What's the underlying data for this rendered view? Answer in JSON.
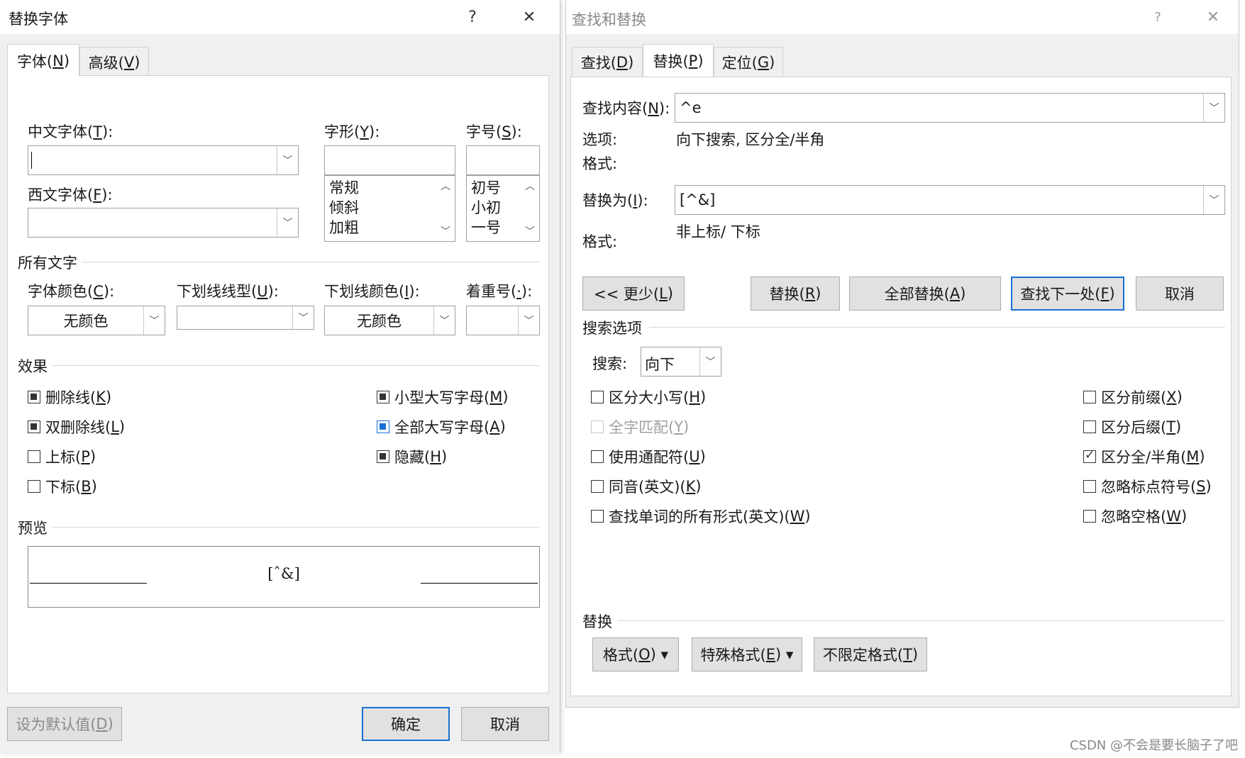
{
  "font_dialog": {
    "title": "替换字体",
    "help": "?",
    "close": "✕",
    "tabs": [
      {
        "label": "字体(",
        "key": "N",
        "end": ")"
      },
      {
        "label": "高级(",
        "key": "V",
        "end": ")"
      }
    ],
    "chinese_font": {
      "label": "中文字体(",
      "key": "T",
      "end": "):",
      "value": ""
    },
    "style": {
      "label": "字形(",
      "key": "Y",
      "end": "):",
      "items": [
        "常规",
        "倾斜",
        "加粗"
      ]
    },
    "size": {
      "label": "字号(",
      "key": "S",
      "end": "):",
      "items": [
        "初号",
        "小初",
        "一号"
      ]
    },
    "western_font": {
      "label": "西文字体(",
      "key": "F",
      "end": "):",
      "value": ""
    },
    "all_text": "所有文字",
    "font_color": {
      "label": "字体颜色(",
      "key": "C",
      "end": "):",
      "value": "无颜色"
    },
    "underline_style": {
      "label": "下划线线型(",
      "key": "U",
      "end": "):",
      "value": ""
    },
    "underline_color": {
      "label": "下划线颜色(",
      "key": "I",
      "end": "):",
      "value": "无颜色"
    },
    "emphasis": {
      "label": "着重号(",
      "key": "·",
      "end": "):",
      "value": ""
    },
    "effects": "效果",
    "effects_left": [
      {
        "label": "删除线(",
        "key": "K",
        "end": ")",
        "state": "indeterminate"
      },
      {
        "label": "双删除线(",
        "key": "L",
        "end": ")",
        "state": "indeterminate"
      },
      {
        "label": "上标(",
        "key": "P",
        "end": ")",
        "state": "unchecked"
      },
      {
        "label": "下标(",
        "key": "B",
        "end": ")",
        "state": "unchecked"
      }
    ],
    "effects_right": [
      {
        "label": "小型大写字母(",
        "key": "M",
        "end": ")",
        "state": "indeterminate"
      },
      {
        "label": "全部大写字母(",
        "key": "A",
        "end": ")",
        "state": "indeterminate-blue"
      },
      {
        "label": "隐藏(",
        "key": "H",
        "end": ")",
        "state": "indeterminate"
      }
    ],
    "preview": "预览",
    "preview_text": "[ˆ&]",
    "set_default": {
      "label": "设为默认值(",
      "key": "D",
      "end": ")"
    },
    "ok": "确定",
    "cancel": "取消"
  },
  "find_dialog": {
    "title": "查找和替换",
    "help": "?",
    "close": "✕",
    "tabs": [
      {
        "label": "查找(",
        "key": "D",
        "end": ")"
      },
      {
        "label": "替换(",
        "key": "P",
        "end": ")"
      },
      {
        "label": "定位(",
        "key": "G",
        "end": ")"
      }
    ],
    "find_what": {
      "label": "查找内容(",
      "key": "N",
      "end": "):",
      "value": "^e"
    },
    "options_label": "选项:",
    "options_value": "向下搜索, 区分全/半角",
    "format_label": "格式:",
    "replace_with": {
      "label": "替换为(",
      "key": "I",
      "end": "):",
      "value": "[^&]"
    },
    "format_value": "非上标/ 下标",
    "buttons": {
      "less": {
        "label": "<< 更少(",
        "key": "L",
        "end": ")"
      },
      "replace": {
        "label": "替换(",
        "key": "R",
        "end": ")"
      },
      "replace_all": {
        "label": "全部替换(",
        "key": "A",
        "end": ")"
      },
      "find_next": {
        "label": "查找下一处(",
        "key": "F",
        "end": ")"
      },
      "cancel": "取消"
    },
    "search_options": "搜索选项",
    "search_label": "搜索:",
    "search_value": "向下",
    "left_opts": [
      {
        "label": "区分大小写(",
        "key": "H",
        "end": ")",
        "state": "unchecked"
      },
      {
        "label": "全字匹配(",
        "key": "Y",
        "end": ")",
        "state": "disabled"
      },
      {
        "label": "使用通配符(",
        "key": "U",
        "end": ")",
        "state": "unchecked"
      },
      {
        "label": "同音(英文)(",
        "key": "K",
        "end": ")",
        "state": "unchecked"
      },
      {
        "label": "查找单词的所有形式(英文)(",
        "key": "W",
        "end": ")",
        "state": "unchecked"
      }
    ],
    "right_opts": [
      {
        "label": "区分前缀(",
        "key": "X",
        "end": ")",
        "state": "unchecked"
      },
      {
        "label": "区分后缀(",
        "key": "T",
        "end": ")",
        "state": "unchecked"
      },
      {
        "label": "区分全/半角(",
        "key": "M",
        "end": ")",
        "state": "checked"
      },
      {
        "label": "忽略标点符号(",
        "key": "S",
        "end": ")",
        "state": "unchecked"
      },
      {
        "label": "忽略空格(",
        "key": "W",
        "end": ")",
        "state": "unchecked"
      }
    ],
    "replace_section": "替换",
    "format_btn": {
      "label": "格式(",
      "key": "O",
      "end": ") ▾"
    },
    "special_btn": {
      "label": "特殊格式(",
      "key": "E",
      "end": ") ▾"
    },
    "no_format_btn": {
      "label": "不限定格式(",
      "key": "T",
      "end": ")"
    }
  },
  "watermark": "CSDN @不会是要长脑子了吧"
}
